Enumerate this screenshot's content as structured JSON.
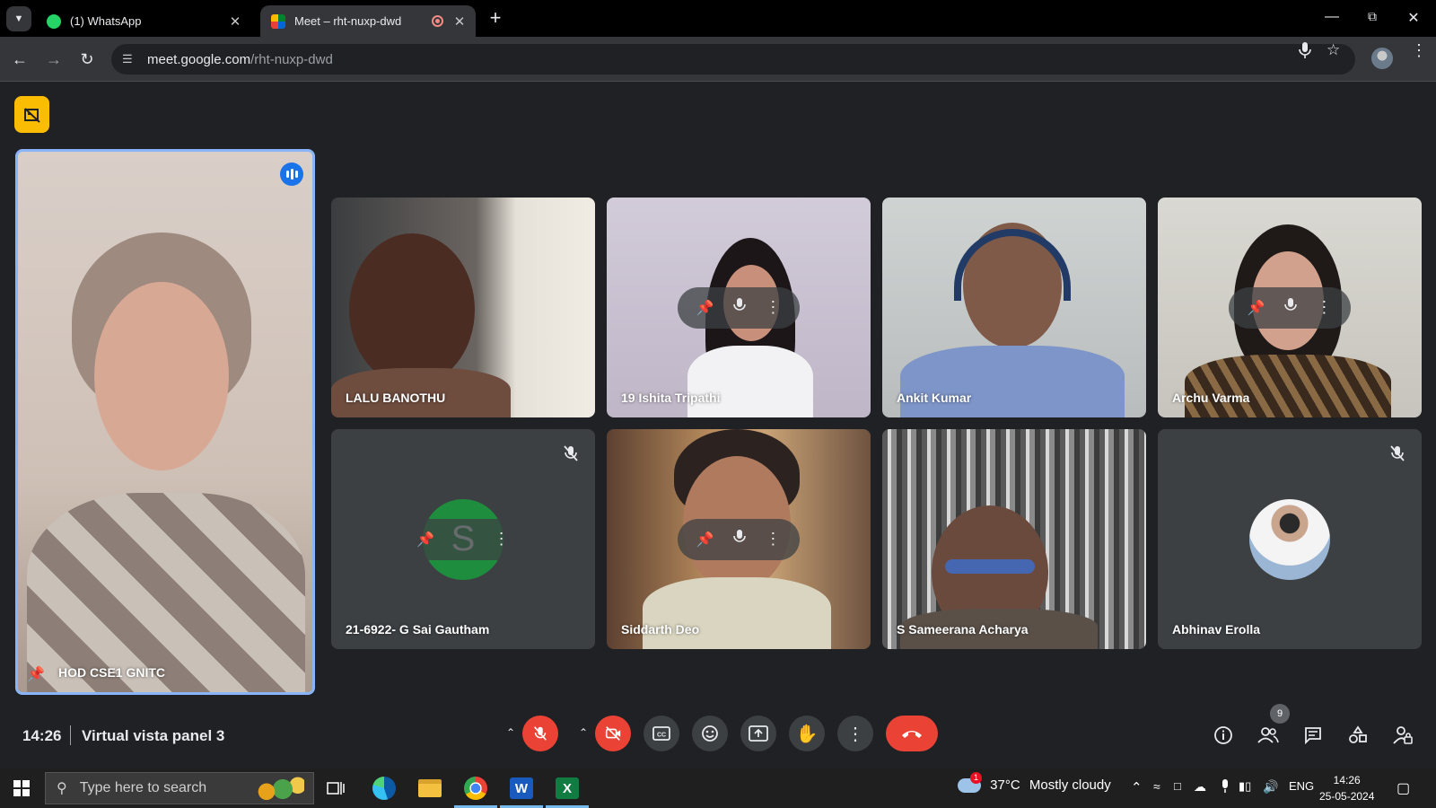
{
  "browser": {
    "tabs": [
      {
        "title": "(1) WhatsApp",
        "active": false
      },
      {
        "title": "Meet – rht-nuxp-dwd",
        "active": true
      }
    ],
    "url_host": "meet.google.com",
    "url_path": "/rht-nuxp-dwd"
  },
  "meet": {
    "featured": {
      "name": "HOD CSE1 GNITC"
    },
    "participants": [
      {
        "name": "LALU BANOTHU"
      },
      {
        "name": "19 Ishita Tripathi"
      },
      {
        "name": "Ankit Kumar"
      },
      {
        "name": "Archu Varma"
      },
      {
        "name": "21-6922- G Sai Gautham",
        "initial": "S"
      },
      {
        "name": "Siddarth Deo"
      },
      {
        "name": "S Sameerana Acharya"
      },
      {
        "name": "Abhinav Erolla"
      }
    ],
    "time": "14:26",
    "meeting_name": "Virtual vista panel 3",
    "people_count": "9"
  },
  "taskbar": {
    "search_placeholder": "Type here to search",
    "weather_temp": "37°C",
    "weather_text": "Mostly cloudy",
    "weather_badge": "1",
    "language": "ENG",
    "time": "14:26",
    "date": "25-05-2024"
  },
  "colors": {
    "meet_bg": "#202124",
    "tile_bg": "#3c4043",
    "danger": "#ea4335",
    "accent": "#8ab4f8",
    "badge": "#fbbc04"
  }
}
